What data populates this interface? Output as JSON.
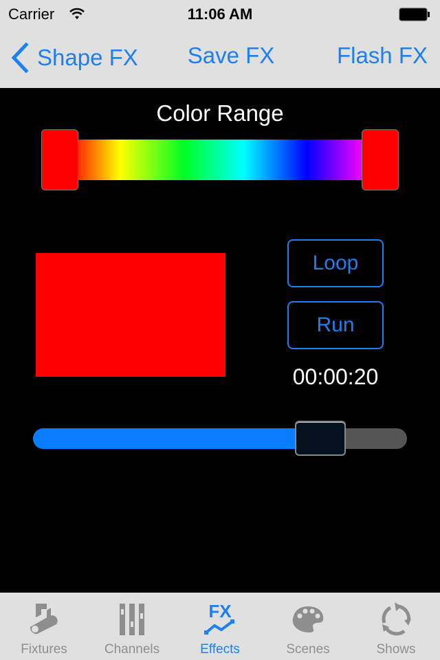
{
  "status_bar": {
    "carrier": "Carrier",
    "time": "11:06 AM",
    "wifi_icon": "wifi-icon",
    "battery_icon": "battery-full-icon"
  },
  "nav": {
    "back_label": "Shape FX",
    "center_label": "Save FX",
    "right_label": "Flash FX",
    "back_icon": "chevron-left-icon"
  },
  "color_range": {
    "title": "Color Range",
    "low_color": "#ff0000",
    "high_color": "#ff0000",
    "gradient_stops": [
      "#ff2a00",
      "#ffff00",
      "#00ff22",
      "#00ffff",
      "#0000ff",
      "#ff00ff"
    ]
  },
  "preview": {
    "color": "#ff0000"
  },
  "controls": {
    "loop_label": "Loop",
    "run_label": "Run",
    "timer": "00:00:20"
  },
  "slider": {
    "value": 0.81
  },
  "colors": {
    "accent": "#1e7ff0",
    "slider_fill": "#0a7cff",
    "inactive_tab": "#8e8e8e"
  },
  "tabs": [
    {
      "label": "Fixtures",
      "icon": "spotlight-icon",
      "active": false
    },
    {
      "label": "Channels",
      "icon": "faders-icon",
      "active": false
    },
    {
      "label": "Effects",
      "icon": "fx-icon",
      "active": true
    },
    {
      "label": "Scenes",
      "icon": "palette-icon",
      "active": false
    },
    {
      "label": "Shows",
      "icon": "cycle-arrows-icon",
      "active": false
    }
  ]
}
